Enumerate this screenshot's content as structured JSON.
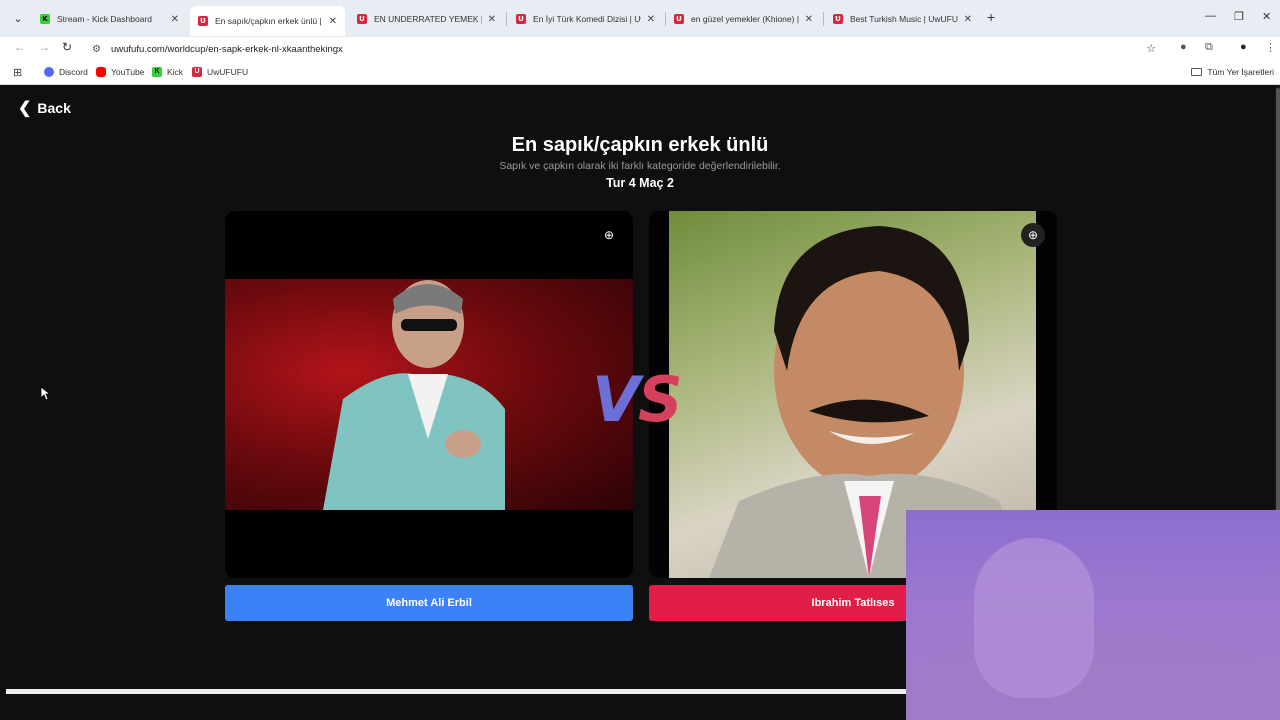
{
  "browser": {
    "tabs": [
      {
        "favicon": "K",
        "favicon_kind": "kick",
        "title": "Stream - Kick Dashboard",
        "active": false
      },
      {
        "favicon": "U",
        "favicon_kind": "uwu",
        "title": "En sapık/çapkın erkek ünlü | Uw",
        "active": true
      },
      {
        "favicon": "U",
        "favicon_kind": "uwu",
        "title": "EN UNDERRATED YEMEK | UwU",
        "active": false
      },
      {
        "favicon": "U",
        "favicon_kind": "uwu",
        "title": "En İyi Türk Komedi Dizisi | UwU",
        "active": false
      },
      {
        "favicon": "U",
        "favicon_kind": "uwu",
        "title": "en güzel yemekler (Khione) | U",
        "active": false
      },
      {
        "favicon": "U",
        "favicon_kind": "uwu",
        "title": "Best Turkish Music | UwUFUFU",
        "active": false
      }
    ],
    "url": "uwufufu.com/worldcup/en-sapk-erkek-nl-xkaanthekingx",
    "bookmarks": [
      {
        "icon": "discord-icon",
        "label": "Discord"
      },
      {
        "icon": "youtube-icon",
        "label": "YouTube"
      },
      {
        "icon": "kick-icon",
        "label": "Kick"
      },
      {
        "icon": "uwufufu-icon",
        "label": "UwUFUFU"
      }
    ],
    "all_bookmarks_label": "Tüm Yer İşaretleri"
  },
  "page": {
    "back_label": "Back",
    "title": "En sapık/çapkın erkek ünlü",
    "subtitle": "Sapık ve çapkın olarak iki farklı kategoride değerlendirilebilir.",
    "round": "Tur 4 Maç 2",
    "vs_v": "V",
    "vs_s": "S",
    "left_choice": "Mehmet Ali Erbil",
    "right_choice": "Ibrahim Tatlıses"
  },
  "colors": {
    "left_button": "#3b82f6",
    "right_button": "#e11d48",
    "vs_v": "#6c6fd6",
    "vs_s": "#d5405c"
  }
}
